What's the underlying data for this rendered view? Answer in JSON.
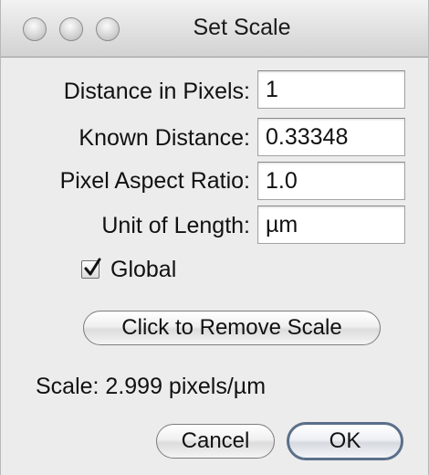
{
  "window": {
    "title": "Set Scale"
  },
  "fields": [
    {
      "label": "Distance in Pixels:",
      "value": "1"
    },
    {
      "label": "Known Distance:",
      "value": "0.33348"
    },
    {
      "label": "Pixel Aspect Ratio:",
      "value": "1.0"
    },
    {
      "label": "Unit of Length:",
      "value": "µm"
    }
  ],
  "global": {
    "label": "Global",
    "checked": true
  },
  "buttons": {
    "remove_scale": "Click to Remove Scale",
    "cancel": "Cancel",
    "ok": "OK"
  },
  "status": {
    "scale_text": "Scale: 2.999 pixels/µm"
  },
  "icons": {
    "window_controls": [
      "close-icon",
      "minimize-icon",
      "zoom-icon"
    ],
    "checkbox": "checkmark-icon"
  }
}
